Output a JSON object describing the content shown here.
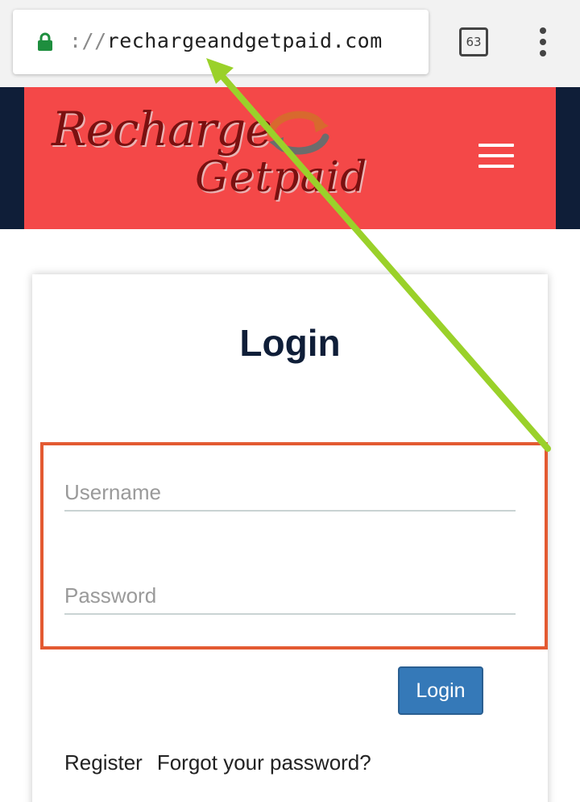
{
  "browser": {
    "url_prefix": "://",
    "url_host": "rechargeandgetpaid.com",
    "tab_count": "63"
  },
  "site": {
    "logo_line1": "Recharge",
    "logo_line2": "Getpaid"
  },
  "login": {
    "title": "Login",
    "username_placeholder": "Username",
    "password_placeholder": "Password",
    "button_label": "Login",
    "register_link": "Register",
    "forgot_link": "Forgot your password?"
  },
  "colors": {
    "header_red": "#f44848",
    "navy": "#0f1e38",
    "button_blue": "#3579b8",
    "annotation_box": "#e35a32",
    "annotation_arrow": "#9ad12a"
  },
  "icons": {
    "lock": "lock-icon",
    "menu": "hamburger-menu-icon",
    "overflow": "more-vert-icon"
  }
}
